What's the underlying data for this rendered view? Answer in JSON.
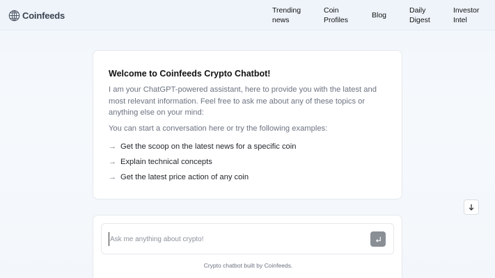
{
  "header": {
    "logo_text": "Coinfeeds",
    "nav": [
      {
        "label": "Trending\nnews"
      },
      {
        "label": "Coin\nProfiles"
      },
      {
        "label": "Blog"
      },
      {
        "label": "Daily\nDigest"
      },
      {
        "label": "Investor\nIntel"
      }
    ]
  },
  "welcome": {
    "title": "Welcome to Coinfeeds Crypto Chatbot!",
    "intro": "I am your ChatGPT-powered assistant, here to provide you with the latest and most relevant information. Feel free to ask me about any of these topics or anything else on your mind:",
    "prompt": "You can start a conversation here or try the following examples:",
    "examples": [
      {
        "label": "Get the scoop on the latest news for a specific coin"
      },
      {
        "label": "Explain technical concepts"
      },
      {
        "label": "Get the latest price action of any coin"
      }
    ]
  },
  "chat_input": {
    "placeholder": "Ask me anything about crypto!",
    "value": ""
  },
  "footer": {
    "note": "Crypto chatbot built by Coinfeeds."
  }
}
